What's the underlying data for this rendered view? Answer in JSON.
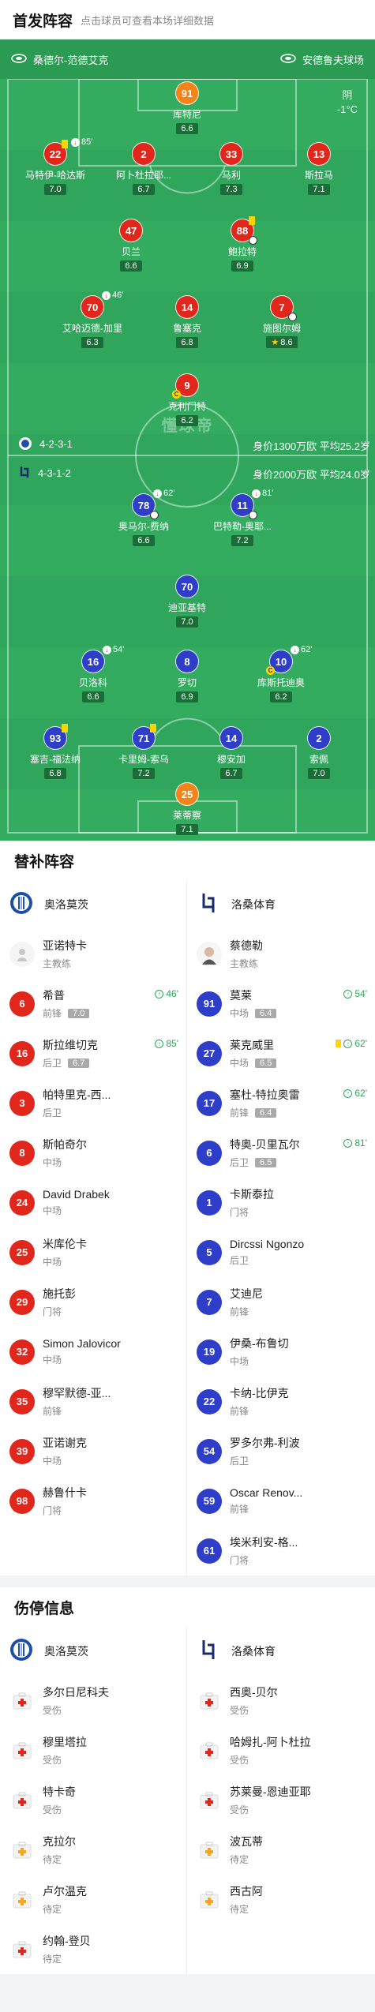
{
  "header": {
    "title": "首发阵容",
    "subtitle": "点击球员可查看本场详细数据"
  },
  "teams": {
    "home": "桑德尔-范德艾克",
    "away": "安德鲁夫球场"
  },
  "weather": {
    "condition": "阴",
    "temp": "-1°C"
  },
  "watermark": "懂球帝",
  "home_formation": {
    "formation": "4-2-3-1",
    "worth": "身价1300万欧 平均25.2岁"
  },
  "away_formation": {
    "formation": "4-3-1-2",
    "worth": "身价2000万欧 平均24.0岁"
  },
  "pitch_players": [
    {
      "num": "91",
      "name": "库特尼",
      "rating": "6.6",
      "color": "orange"
    },
    {
      "num": "22",
      "name": "马特伊-哈达斯",
      "rating": "7.0",
      "color": "red",
      "yc": true,
      "sub": "85'"
    },
    {
      "num": "2",
      "name": "阿卜杜拉耶...",
      "rating": "6.7",
      "color": "red"
    },
    {
      "num": "33",
      "name": "马利",
      "rating": "7.3",
      "color": "red"
    },
    {
      "num": "13",
      "name": "斯拉马",
      "rating": "7.1",
      "color": "red"
    },
    {
      "num": "47",
      "name": "贝兰",
      "rating": "6.6",
      "color": "red"
    },
    {
      "num": "88",
      "name": "鲍拉特",
      "rating": "6.9",
      "color": "red",
      "yc": true,
      "ball": true
    },
    {
      "num": "70",
      "name": "艾哈迈德-加里",
      "rating": "6.3",
      "color": "red",
      "sub": "46'"
    },
    {
      "num": "14",
      "name": "鲁塞克",
      "rating": "6.8",
      "color": "red"
    },
    {
      "num": "7",
      "name": "施图尔姆",
      "rating": "8.6",
      "color": "red",
      "ball": true,
      "star": true
    },
    {
      "num": "9",
      "name": "克利门特",
      "rating": "6.2",
      "color": "red",
      "captain": true
    },
    {
      "num": "78",
      "name": "奥马尔-费纳",
      "rating": "6.6",
      "color": "blue",
      "sub": "62'",
      "ball": true
    },
    {
      "num": "11",
      "name": "巴特勒-奥耶...",
      "rating": "7.2",
      "color": "blue",
      "sub": "81'",
      "ball": true
    },
    {
      "num": "70",
      "name": "迪亚基特",
      "rating": "7.0",
      "color": "blue"
    },
    {
      "num": "16",
      "name": "贝洛科",
      "rating": "6.6",
      "color": "blue",
      "sub": "54'"
    },
    {
      "num": "8",
      "name": "罗切",
      "rating": "6.9",
      "color": "blue"
    },
    {
      "num": "10",
      "name": "库斯托迪奥",
      "rating": "6.2",
      "color": "blue",
      "sub": "62'",
      "captain": true
    },
    {
      "num": "93",
      "name": "塞吉-福法纳",
      "rating": "6.8",
      "color": "blue",
      "yc": true
    },
    {
      "num": "71",
      "name": "卡里姆-索乌",
      "rating": "7.2",
      "color": "blue",
      "yc": true
    },
    {
      "num": "14",
      "name": "穆安加",
      "rating": "6.7",
      "color": "blue"
    },
    {
      "num": "2",
      "name": "索佩",
      "rating": "7.0",
      "color": "blue"
    },
    {
      "num": "25",
      "name": "莱蒂察",
      "rating": "7.1",
      "color": "orange"
    }
  ],
  "subs": {
    "title": "替补阵容",
    "home_team": "奥洛莫茨",
    "away_team": "洛桑体育",
    "home_coach": {
      "name": "亚诺特卡",
      "role": "主教练"
    },
    "away_coach": {
      "name": "蔡德勒",
      "role": "主教练"
    },
    "home": [
      {
        "num": "6",
        "name": "希普",
        "pos": "前锋",
        "rating": "7.0",
        "in": "46'"
      },
      {
        "num": "16",
        "name": "斯拉维切克",
        "pos": "后卫",
        "rating": "6.7",
        "in": "85'"
      },
      {
        "num": "3",
        "name": "帕特里克-西...",
        "pos": "后卫"
      },
      {
        "num": "8",
        "name": "斯帕奇尔",
        "pos": "中场"
      },
      {
        "num": "24",
        "name": "David Drabek",
        "pos": "中场"
      },
      {
        "num": "25",
        "name": "米库伦卡",
        "pos": "中场"
      },
      {
        "num": "29",
        "name": "施托彭",
        "pos": "门将"
      },
      {
        "num": "32",
        "name": "Simon Jalovicor",
        "pos": "中场"
      },
      {
        "num": "35",
        "name": "穆罕默德-亚...",
        "pos": "前锋"
      },
      {
        "num": "39",
        "name": "亚诺谢克",
        "pos": "中场"
      },
      {
        "num": "98",
        "name": "赫鲁什卡",
        "pos": "门将"
      }
    ],
    "away": [
      {
        "num": "91",
        "name": "莫莱",
        "pos": "中场",
        "rating": "6.4",
        "in": "54'"
      },
      {
        "num": "27",
        "name": "莱克威里",
        "pos": "中场",
        "rating": "6.5",
        "in": "62'",
        "yc": true
      },
      {
        "num": "17",
        "name": "塞杜-特拉奥雷",
        "pos": "前锋",
        "rating": "6.4",
        "in": "62'"
      },
      {
        "num": "6",
        "name": "特奥-贝里瓦尔",
        "pos": "后卫",
        "rating": "6.5",
        "in": "81'"
      },
      {
        "num": "1",
        "name": "卡斯泰拉",
        "pos": "门将"
      },
      {
        "num": "5",
        "name": "Dircssi Ngonzo",
        "pos": "后卫"
      },
      {
        "num": "7",
        "name": "艾迪尼",
        "pos": "前锋"
      },
      {
        "num": "19",
        "name": "伊桑-布鲁切",
        "pos": "中场"
      },
      {
        "num": "22",
        "name": "卡纳-比伊克",
        "pos": "前锋"
      },
      {
        "num": "54",
        "name": "罗多尔弗-利波",
        "pos": "后卫"
      },
      {
        "num": "59",
        "name": "Oscar Renov...",
        "pos": "前锋"
      },
      {
        "num": "61",
        "name": "埃米利安-格...",
        "pos": "门将"
      }
    ]
  },
  "injuries": {
    "title": "伤停信息",
    "home_team": "奥洛莫茨",
    "away_team": "洛桑体育",
    "home": [
      {
        "name": "多尔日尼科夫",
        "status": "受伤",
        "kind": "red"
      },
      {
        "name": "穆里塔拉",
        "status": "受伤",
        "kind": "red"
      },
      {
        "name": "特卡奇",
        "status": "受伤",
        "kind": "red"
      },
      {
        "name": "克拉尔",
        "status": "待定",
        "kind": "yellow"
      },
      {
        "name": "卢尔温克",
        "status": "待定",
        "kind": "yellow"
      },
      {
        "name": "约翰-登贝",
        "status": "待定",
        "kind": "red"
      }
    ],
    "away": [
      {
        "name": "西奥-贝尔",
        "status": "受伤",
        "kind": "red"
      },
      {
        "name": "哈姆扎-阿卜杜拉",
        "status": "受伤",
        "kind": "red"
      },
      {
        "name": "苏莱曼-恩迪亚耶",
        "status": "受伤",
        "kind": "red"
      },
      {
        "name": "波瓦蒂",
        "status": "待定",
        "kind": "yellow"
      },
      {
        "name": "西古阿",
        "status": "待定",
        "kind": "yellow"
      }
    ]
  }
}
